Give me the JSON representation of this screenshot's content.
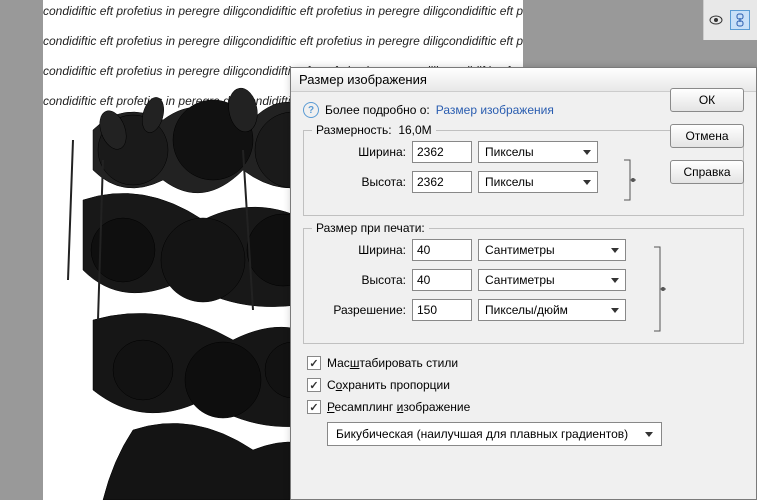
{
  "dialog": {
    "title": "Размер изображения",
    "help_prefix": "Более подробно о:",
    "help_link": "Размер изображения"
  },
  "dimensions": {
    "title": "Размерность:",
    "size": "16,0M",
    "width_label": "Ширина:",
    "width_value": "2362",
    "height_label": "Высота:",
    "height_value": "2362",
    "unit": "Пикселы"
  },
  "print": {
    "title": "Размер при печати:",
    "width_label": "Ширина:",
    "width_value": "40",
    "height_label": "Высота:",
    "height_value": "40",
    "res_label": "Разрешение:",
    "res_value": "150",
    "cm_unit": "Сантиметры",
    "res_unit": "Пикселы/дюйм"
  },
  "checks": {
    "scale_styles": "Масштабировать стили",
    "constrain": "Сохранить пропорции",
    "resample": "Ресамплинг изображение"
  },
  "resample_method": "Бикубическая (наилучшая для плавных градиентов)",
  "buttons": {
    "ok": "ОК",
    "cancel": "Отмена",
    "help": "Справка"
  },
  "icons": {
    "eye": "eye-icon",
    "link": "link-icon"
  }
}
